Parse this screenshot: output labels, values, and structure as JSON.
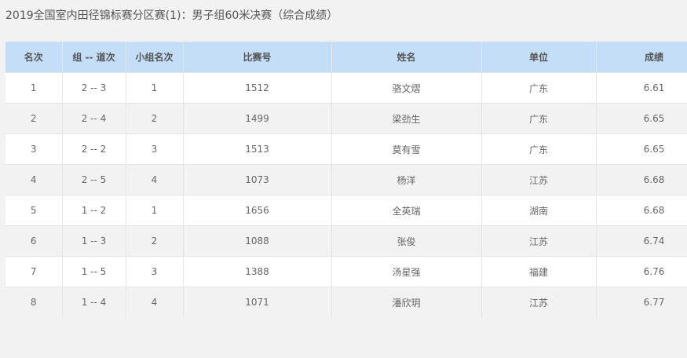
{
  "title": "2019全国室内田径锦标赛分区赛(1)：男子组60米决赛（综合成绩）",
  "columns": [
    "名次",
    "组 -- 道次",
    "小组名次",
    "比赛号",
    "姓名",
    "单位",
    "成绩"
  ],
  "rows": [
    [
      "1",
      "2 -- 3",
      "1",
      "1512",
      "骆文熠",
      "广东",
      "6.61"
    ],
    [
      "2",
      "2 -- 4",
      "2",
      "1499",
      "梁劲生",
      "广东",
      "6.65"
    ],
    [
      "3",
      "2 -- 2",
      "3",
      "1513",
      "莫有雪",
      "广东",
      "6.65"
    ],
    [
      "4",
      "2 -- 5",
      "4",
      "1073",
      "杨洋",
      "江苏",
      "6.68"
    ],
    [
      "5",
      "1 -- 2",
      "1",
      "1656",
      "全英瑞",
      "湖南",
      "6.68"
    ],
    [
      "6",
      "1 -- 3",
      "2",
      "1088",
      "张俊",
      "江苏",
      "6.74"
    ],
    [
      "7",
      "1 -- 5",
      "3",
      "1388",
      "汤星强",
      "福建",
      "6.76"
    ],
    [
      "8",
      "1 -- 4",
      "4",
      "1071",
      "潘欣玥",
      "江苏",
      "6.77"
    ]
  ],
  "colors": {
    "header_bg": "#c4def8",
    "row_alt": "#f2f2f2"
  }
}
